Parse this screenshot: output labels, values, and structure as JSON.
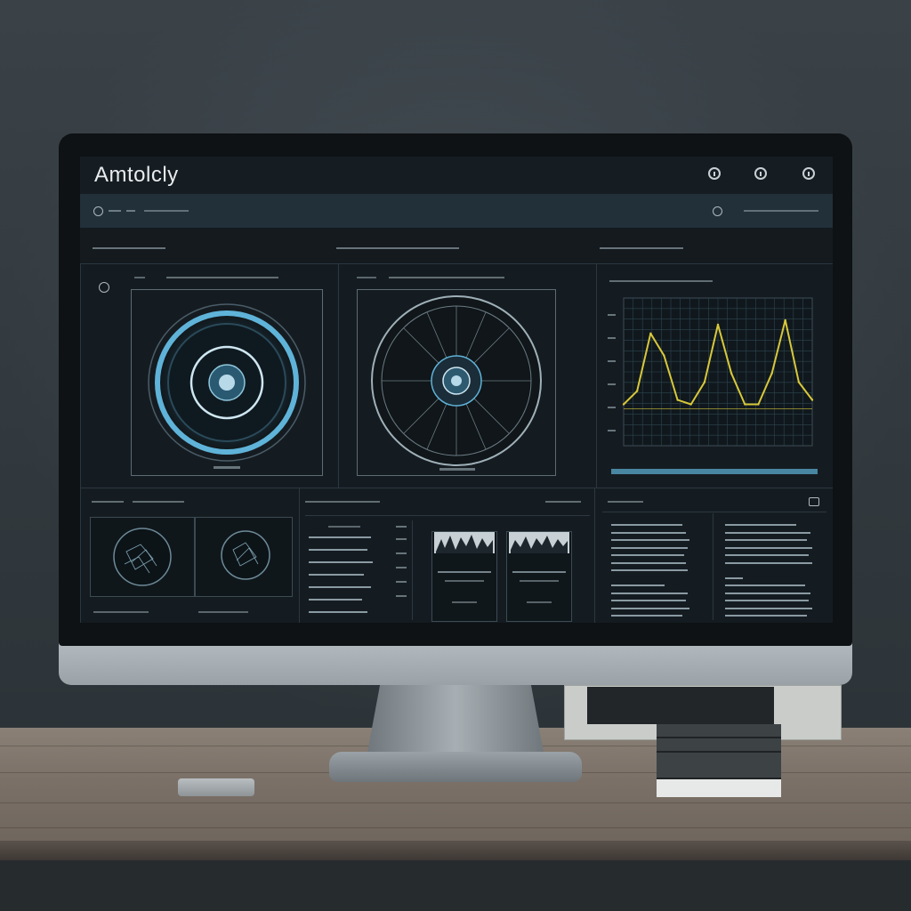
{
  "app": {
    "title": "Amtolcly"
  },
  "colors": {
    "accent": "#5fb3d9",
    "wave": "#d8c83a",
    "panel_bg": "#151c21"
  },
  "window_buttons": [
    "clock-icon",
    "clock-icon",
    "circle-icon"
  ],
  "chart_data": {
    "type": "line",
    "title": "",
    "xlabel": "",
    "ylabel": "",
    "series": [
      {
        "name": "",
        "values": [
          0.05,
          0.2,
          0.85,
          0.6,
          0.1,
          0.05,
          0.3,
          0.95,
          0.4,
          0.05,
          0.05,
          0.4,
          1.0,
          0.3,
          0.1
        ]
      }
    ],
    "grid": true
  }
}
